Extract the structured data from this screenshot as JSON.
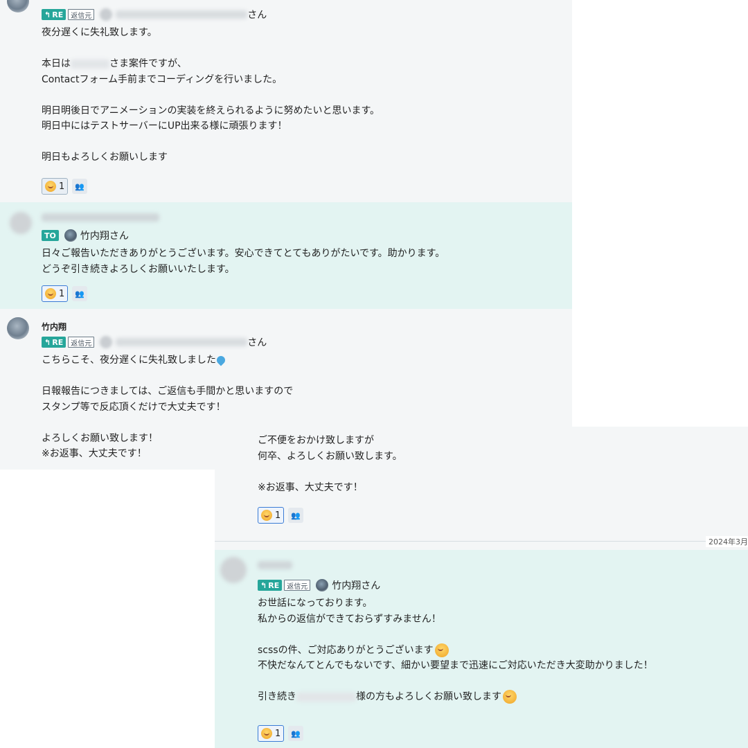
{
  "messages": [
    {
      "reply_badge": "RE",
      "origin_label": "返信元",
      "mention_suffix": "さん",
      "body": [
        "夜分遅くに失礼致します。",
        "",
        "本日は",
        "さま案件ですが、",
        "Contactフォーム手前までコーディングを行いました。",
        "",
        "明日明後日でアニメーションの実装を終えられるように努めたいと思います。",
        "明日中にはテストサーバーにUP出来る様に頑張ります！",
        "",
        "明日もよろしくお願いします"
      ],
      "reaction_count": "1"
    },
    {
      "to_badge": "TO",
      "mention_name": "竹内翔さん",
      "body": [
        "日々ご報告いただきありがとうございます。安心できてとてもありがたいです。助かります。",
        "どうぞ引き続きよろしくお願いいたします。"
      ],
      "reaction_count": "1"
    },
    {
      "sender": "竹内翔",
      "reply_badge": "RE",
      "origin_label": "返信元",
      "mention_suffix": "さん",
      "body": [
        "こちらこそ、夜分遅くに失礼致しました",
        "",
        "日報報告につきましては、ご返信も手間かと思いますので",
        "スタンプ等で反応頂くだけで大丈夫です！",
        "",
        "よろしくお願い致します！",
        "※お返事、大丈夫です！"
      ]
    },
    {
      "body": [
        "ご不便をおかけ致しますが",
        "何卒、よろしくお願い致します。",
        "",
        "※お返事、大丈夫です！"
      ],
      "reaction_count": "1"
    },
    {
      "reply_badge": "RE",
      "origin_label": "返信元",
      "mention_name": "竹内翔さん",
      "body": [
        "お世話になっております。",
        "私からの返信ができておらずすみません！",
        "",
        "scssの件、ご対応ありがとうございます",
        "不快だなんてとんでもないです、細かい要望まで迅速にご対応いただき大変助かりました！",
        "",
        "引き続き",
        "様の方もよろしくお願い致します"
      ],
      "reaction_count": "1"
    }
  ],
  "date_divider": "2024年3月",
  "icons": {
    "reply": "reply-arrow-icon",
    "reaction_users": "reaction-users-icon",
    "emoji": "emoji-face-icon"
  }
}
